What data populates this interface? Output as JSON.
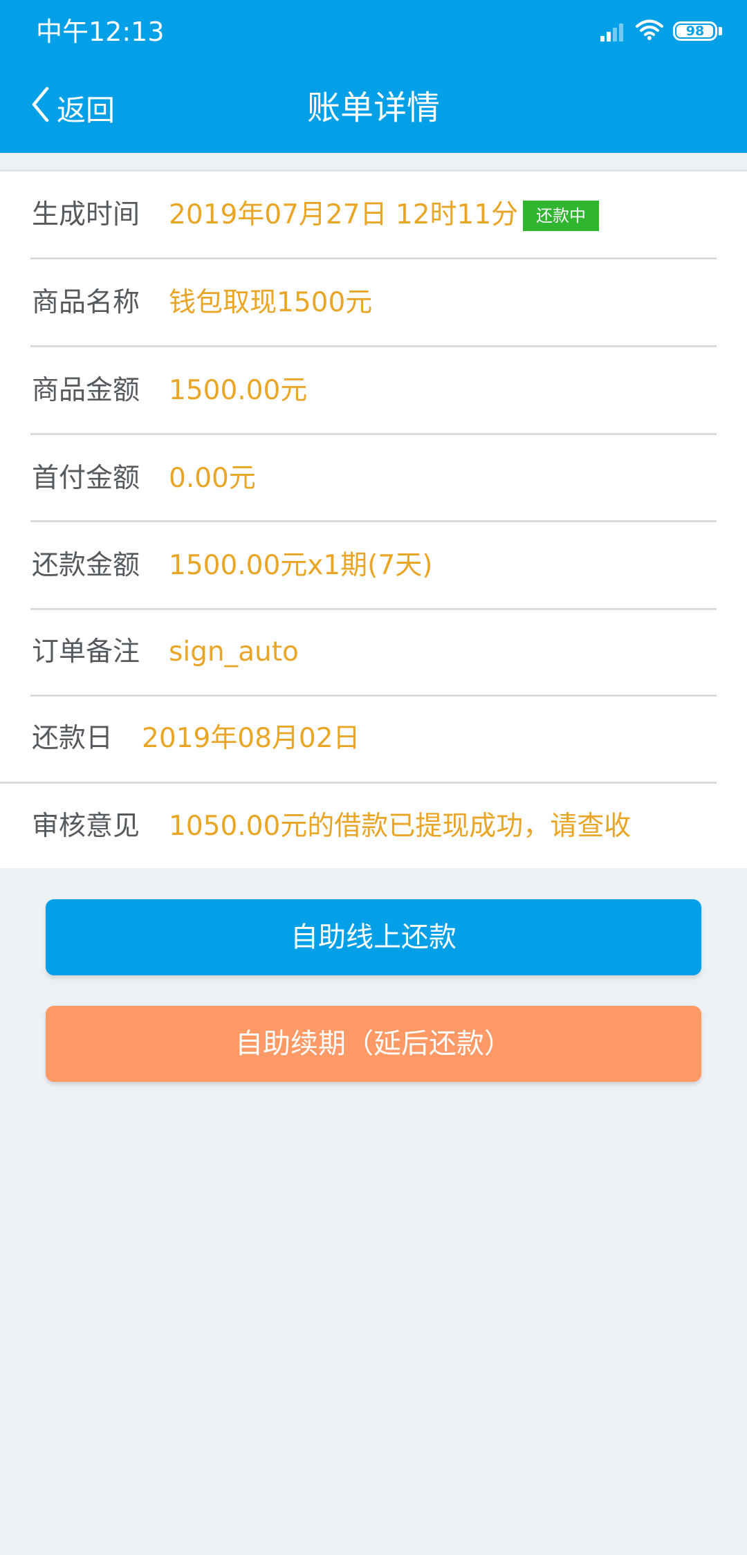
{
  "status_bar": {
    "time": "中午12:13",
    "battery": "98",
    "battery_level": 0.98
  },
  "header": {
    "back_label": "返回",
    "title": "账单详情"
  },
  "detail": {
    "rows": [
      {
        "label": "生成时间",
        "value": "2019年07月27日 12时11分",
        "badge": "还款中"
      },
      {
        "label": "商品名称",
        "value": "钱包取现1500元"
      },
      {
        "label": "商品金额",
        "value": "1500.00元"
      },
      {
        "label": "首付金额",
        "value": "0.00元"
      },
      {
        "label": "还款金额",
        "value": "1500.00元x1期(7天)"
      },
      {
        "label": "订单备注",
        "value": "sign_auto"
      },
      {
        "label": "还款日",
        "value": "2019年08月02日"
      },
      {
        "label": "审核意见",
        "value": "1050.00元的借款已提现成功，请查收"
      }
    ]
  },
  "actions": {
    "repay_label": "自助线上还款",
    "renew_label": "自助续期（延后还款）"
  },
  "colors": {
    "brand_blue": "#03a0e8",
    "value_orange": "#e9a526",
    "badge_green": "#2fb52f",
    "renew_orange": "#ff9966"
  },
  "icons": {
    "signal": "signal-icon",
    "wifi": "wifi-icon",
    "battery": "battery-icon",
    "back": "chevron-left-icon"
  }
}
